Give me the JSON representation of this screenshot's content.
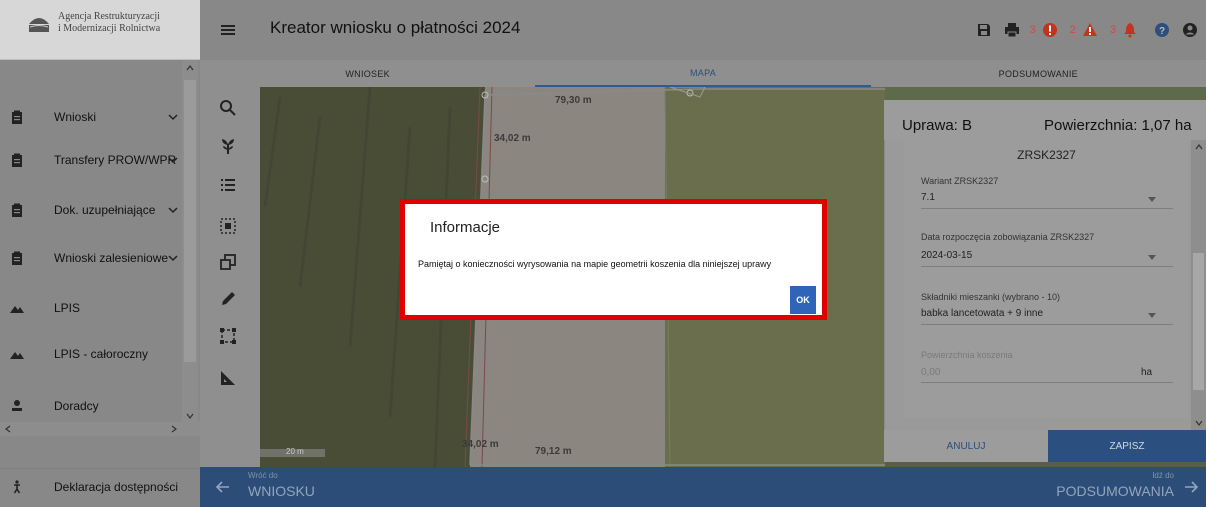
{
  "brand": {
    "line1": "Agencja Restrukturyzacji",
    "line2": "i Modernizacji Rolnictwa"
  },
  "header": {
    "title": "Kreator wniosku o płatności 2024",
    "counts": {
      "errors": "3",
      "warnings": "2",
      "alerts": "3"
    }
  },
  "sidebar": {
    "items": [
      {
        "label": "Wnioski",
        "icon": "clipboard-icon"
      },
      {
        "label": "Transfery PROW/WPR",
        "icon": "clipboard-icon"
      },
      {
        "label": "Dok. uzupełniające",
        "icon": "clipboard-icon"
      },
      {
        "label": "Wnioski zalesieniowe",
        "icon": "clipboard-icon"
      },
      {
        "label": "LPIS",
        "icon": "mountain-icon"
      },
      {
        "label": "LPIS - całoroczny",
        "icon": "mountain-icon"
      },
      {
        "label": "Doradcy",
        "icon": "person-icon"
      }
    ],
    "footer_label": "Deklaracja dostępności"
  },
  "tabs": [
    {
      "label": "WNIOSEK"
    },
    {
      "label": "MAPA"
    },
    {
      "label": "PODSUMOWANIE"
    }
  ],
  "map": {
    "dims": {
      "top": "79,30 m",
      "left": "34,02 m",
      "bottom": "79,12 m",
      "bottom_left": "34,02 m"
    },
    "scale": "20 m"
  },
  "panel": {
    "crop_label": "Uprawa: B",
    "area_label": "Powierzchnia: 1,07 ha",
    "section_title": "ZRSK2327",
    "fields": {
      "variant": {
        "label": "Wariant ZRSK2327",
        "value": "7.1"
      },
      "start_date": {
        "label": "Data rozpoczęcia zobowiązania ZRSK2327",
        "value": "2024-03-15"
      },
      "mixture": {
        "label": "Składniki mieszanki (wybrano - 10)",
        "value": "babka lancetowata + 9 inne"
      },
      "mowing_area": {
        "label": "Powierzchnia koszenia",
        "value": "0,00",
        "unit": "ha"
      }
    },
    "cancel_label": "ANULUJ",
    "save_label": "ZAPISZ"
  },
  "bottom_nav": {
    "back_small": "Wróć do",
    "back_big": "WNIOSKU",
    "next_small": "Idź do",
    "next_big": "PODSUMOWANIA"
  },
  "modal": {
    "title": "Informacje",
    "message": "Pamiętaj o konieczności wyrysowania na mapie geometrii koszenia dla niniejszej uprawy",
    "ok_label": "OK"
  },
  "colors": {
    "primary": "#2c4d77",
    "highlight": "#e00000",
    "ok": "#2f64b8"
  }
}
